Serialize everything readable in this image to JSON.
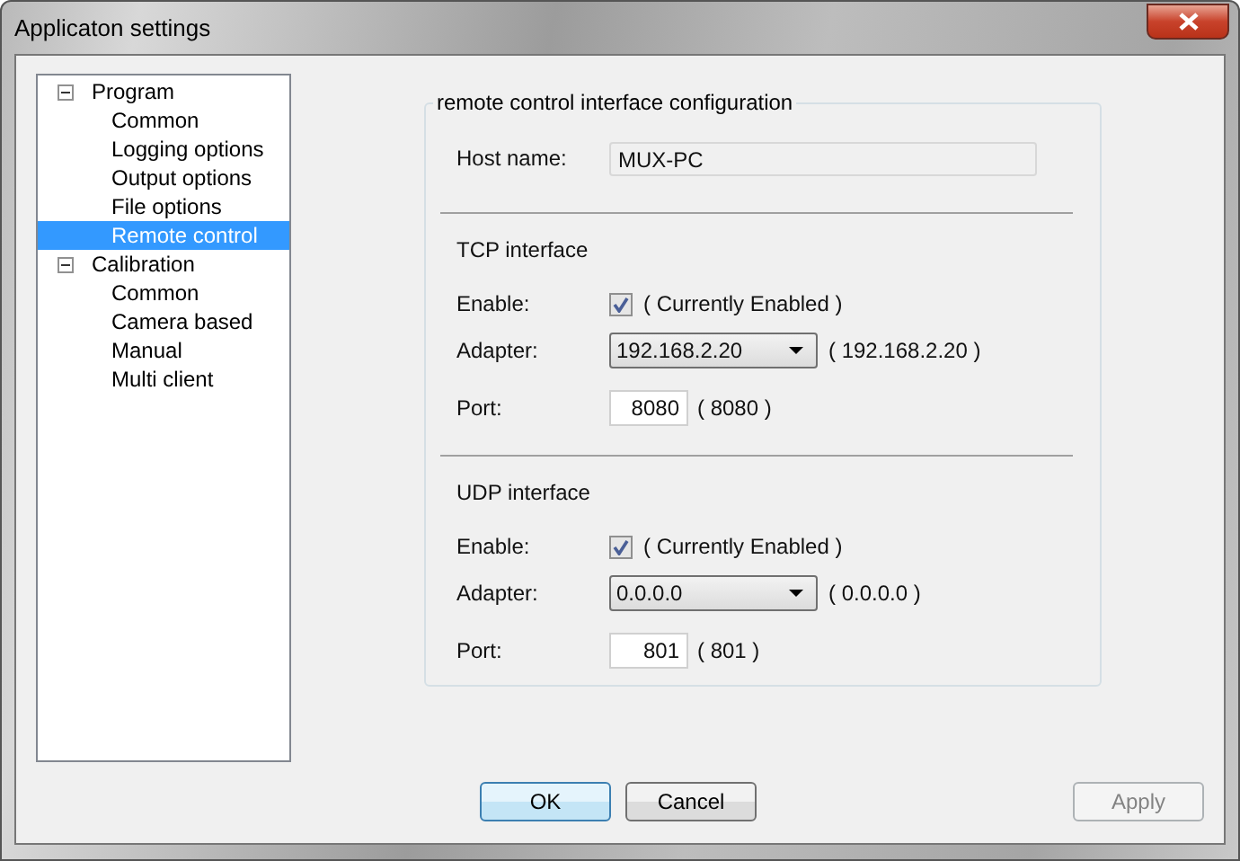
{
  "window": {
    "title": "Applicaton settings"
  },
  "tree": [
    {
      "label": "Program",
      "expanded": true,
      "selected": false,
      "children": [
        {
          "label": "Common",
          "selected": false
        },
        {
          "label": "Logging options",
          "selected": false
        },
        {
          "label": "Output options",
          "selected": false
        },
        {
          "label": "File options",
          "selected": false
        },
        {
          "label": "Remote control",
          "selected": true
        }
      ]
    },
    {
      "label": "Calibration",
      "expanded": true,
      "selected": false,
      "children": [
        {
          "label": "Common",
          "selected": false
        },
        {
          "label": "Camera based",
          "selected": false
        },
        {
          "label": "Manual",
          "selected": false
        },
        {
          "label": "Multi client",
          "selected": false
        }
      ]
    }
  ],
  "group": {
    "title": "remote control interface configuration",
    "host_name": {
      "label": "Host name:",
      "value": "MUX-PC"
    },
    "sections": [
      {
        "title": "TCP interface",
        "enable": {
          "label": "Enable:",
          "checked": true,
          "status": "( Currently Enabled )"
        },
        "adapter": {
          "label": "Adapter:",
          "value": "192.168.2.20",
          "reading": "( 192.168.2.20 )"
        },
        "port": {
          "label": "Port:",
          "value": "8080",
          "reading": "( 8080 )"
        }
      },
      {
        "title": "UDP interface",
        "enable": {
          "label": "Enable:",
          "checked": true,
          "status": "( Currently Enabled )"
        },
        "adapter": {
          "label": "Adapter:",
          "value": "0.0.0.0",
          "reading": "( 0.0.0.0 )"
        },
        "port": {
          "label": "Port:",
          "value": "801",
          "reading": "( 801 )"
        }
      }
    ]
  },
  "buttons": [
    {
      "label": "OK",
      "kind": "default",
      "disabled": false
    },
    {
      "label": "Cancel",
      "kind": "normal",
      "disabled": false
    },
    {
      "label": "Apply",
      "kind": "normal",
      "disabled": true
    }
  ]
}
